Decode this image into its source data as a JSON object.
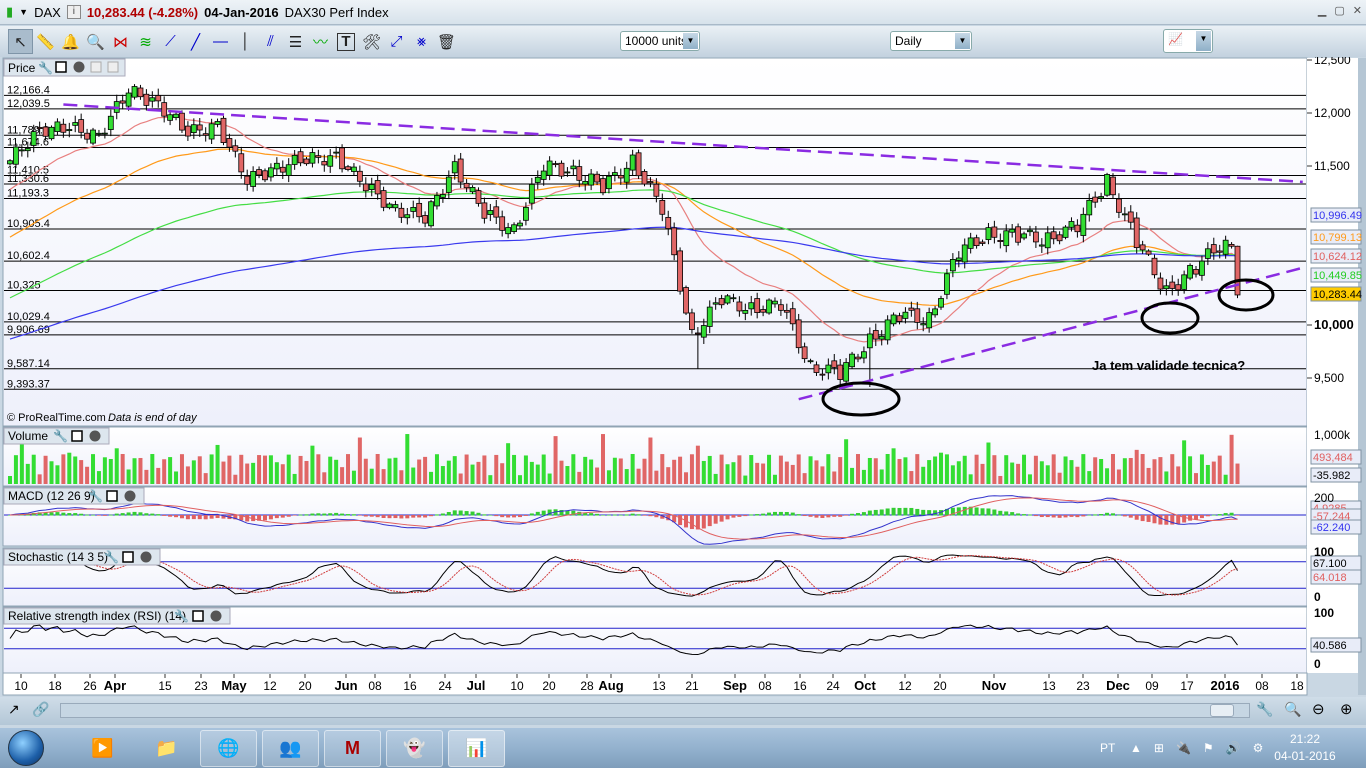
{
  "title": {
    "symbol": "DAX",
    "price": "10,283.44 (-4.28%)",
    "date": "04-Jan-2016",
    "name": "DAX30 Perf Index"
  },
  "toolbar": {
    "units": "10000 units",
    "timeframe": "Daily"
  },
  "panels": {
    "price": "Price",
    "volume": "Volume",
    "macd": "MACD (12 26 9)",
    "stoch": "Stochastic (14 3 5)",
    "rsi": "Relative strength index (RSI) (14)"
  },
  "footer": {
    "copyright": "© ProRealTime.com",
    "note": "Data is end of day"
  },
  "annotation": "Ja tem validade tecnica?",
  "chart_data": {
    "type": "candlestick",
    "symbol": "DAX",
    "weekly_closes": [
      11550,
      11850,
      11850,
      11800,
      12200,
      12100,
      11800,
      11900,
      11350,
      11500,
      11550,
      11600,
      11300,
      11100,
      11000,
      11500,
      11050,
      10900,
      11500,
      11450,
      11300,
      11550,
      11100,
      9900,
      10250,
      10150,
      10200,
      9600,
      9550,
      9850,
      10100,
      10050,
      10700,
      10850,
      10850,
      10800,
      10950,
      11350,
      10800,
      10300,
      10550,
      10800
    ],
    "last": {
      "open": 10743,
      "close": 10283.44
    },
    "ylim": [
      9200,
      12700
    ],
    "price_ticks": [
      "12,500",
      "12,000",
      "11,500",
      "10,000",
      "9,500"
    ],
    "price_tick_values": [
      12500,
      12000,
      11500,
      10000,
      9500
    ],
    "levels": [
      "12,166.4",
      "12,039.5",
      "11,789.8",
      "11,674.6",
      "11,410.5",
      "11,330.6",
      "11,193.3",
      "10,905.4",
      "10,602.4",
      "10,325",
      "10,029.4",
      "9,906.69",
      "9,587.14",
      "9,393.37"
    ],
    "level_values": [
      12166.4,
      12039.5,
      11789.8,
      11674.6,
      11410.5,
      11330.6,
      11193.3,
      10905.4,
      10602.4,
      10325,
      10029.4,
      9906.69,
      9587.14,
      9393.37
    ],
    "ma_seeds": {
      "red": 11250,
      "orange": 10800,
      "green": 10230,
      "blue": 9850
    },
    "trendlines": [
      {
        "from": [
          9,
          12080
        ],
        "to": [
          218,
          11350
        ]
      },
      {
        "from": [
          133,
          9300
        ],
        "to": [
          218,
          10540
        ]
      }
    ],
    "x_labels": [
      "10",
      "18",
      "26",
      "Apr",
      "15",
      "23",
      "May",
      "12",
      "20",
      "Jun",
      "08",
      "16",
      "24",
      "Jul",
      "10",
      "20",
      "28",
      "Aug",
      "13",
      "21",
      "Sep",
      "08",
      "16",
      "24",
      "Oct",
      "12",
      "20",
      "Nov",
      "13",
      "23",
      "Dec",
      "09",
      "17",
      "2016",
      "08",
      "18"
    ],
    "right_labels": {
      "ma200": "10,996.49",
      "ma100": "10,799.13",
      "ma20": "10,624.12",
      "ma50": "10,449.85",
      "last": "10,283.44",
      "vol_top": "1,000k",
      "vol_val": "493,484",
      "vol_val2": "-35.982",
      "macd_top": "200",
      "macd_sig": "4.9285",
      "macd_hist": "-57.244",
      "macd_val": "-62.240",
      "stoch_top": "100",
      "stoch_k": "67.100",
      "stoch_d": "64.018",
      "stoch_zero": "0",
      "rsi_top": "100",
      "rsi_val": "40.586",
      "rsi_zero": "0"
    }
  },
  "taskbar": {
    "lang": "PT",
    "time": "21:22",
    "date": "04-01-2016"
  }
}
